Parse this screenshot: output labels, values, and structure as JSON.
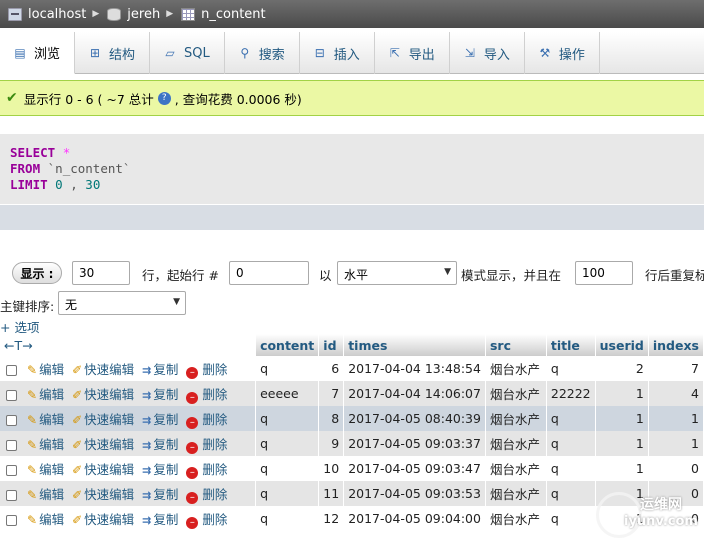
{
  "breadcrumb": {
    "server": "localhost",
    "database": "jereh",
    "table": "n_content"
  },
  "tabs": [
    {
      "label": "浏览",
      "icon": "browse-icon"
    },
    {
      "label": "结构",
      "icon": "structure-icon"
    },
    {
      "label": "SQL",
      "icon": "sql-icon"
    },
    {
      "label": "搜索",
      "icon": "search-icon"
    },
    {
      "label": "插入",
      "icon": "insert-icon"
    },
    {
      "label": "导出",
      "icon": "export-icon"
    },
    {
      "label": "导入",
      "icon": "import-icon"
    },
    {
      "label": "操作",
      "icon": "operations-icon"
    }
  ],
  "notice": {
    "prefix": "显示行 0 - 6 ( ~7 总计",
    "suffix": ", 查询花费 0.0006 秒)"
  },
  "sql": {
    "line1_kw": "SELECT",
    "line1_rest": "*",
    "line2_kw": "FROM",
    "line2_rest": "`n_content`",
    "line3_kw": "LIMIT",
    "line3_a": "0",
    "line3_sep": ",",
    "line3_b": "30"
  },
  "nav": {
    "show_label": "显示 :",
    "rows_value": "30",
    "start_label": "行，起始行 #",
    "start_value": "0",
    "in_label": "以",
    "mode_value": "水平",
    "mode_label": "模式显示，并且在",
    "repeat_value": "100",
    "repeat_label": "行后重复标",
    "sort_label": "主键排序:",
    "sort_value": "无",
    "options_label": "+ 选项",
    "arrows_label": "←T→"
  },
  "columns": [
    "content",
    "id",
    "times",
    "src",
    "title",
    "userid",
    "indexs"
  ],
  "actions": {
    "edit": "编辑",
    "quick_edit": "快速编辑",
    "copy": "复制",
    "delete": "删除"
  },
  "rows": [
    {
      "content": "q",
      "id": "6",
      "times": "2017-04-04 13:48:54",
      "src": "烟台水产",
      "title": "q",
      "userid": "2",
      "indexs": "7"
    },
    {
      "content": "eeeee",
      "id": "7",
      "times": "2017-04-04 14:06:07",
      "src": "烟台水产",
      "title": "22222",
      "userid": "1",
      "indexs": "4"
    },
    {
      "content": "q",
      "id": "8",
      "times": "2017-04-05 08:40:39",
      "src": "烟台水产",
      "title": "q",
      "userid": "1",
      "indexs": "1"
    },
    {
      "content": "q",
      "id": "9",
      "times": "2017-04-05 09:03:37",
      "src": "烟台水产",
      "title": "q",
      "userid": "1",
      "indexs": "1"
    },
    {
      "content": "q",
      "id": "10",
      "times": "2017-04-05 09:03:47",
      "src": "烟台水产",
      "title": "q",
      "userid": "1",
      "indexs": "0"
    },
    {
      "content": "q",
      "id": "11",
      "times": "2017-04-05 09:03:53",
      "src": "烟台水产",
      "title": "q",
      "userid": "1",
      "indexs": "0"
    },
    {
      "content": "q",
      "id": "12",
      "times": "2017-04-05 09:04:00",
      "src": "烟台水产",
      "title": "q",
      "userid": "1",
      "indexs": "0"
    }
  ],
  "watermark": {
    "line1": "运维网",
    "line2": "iyunv.com"
  }
}
